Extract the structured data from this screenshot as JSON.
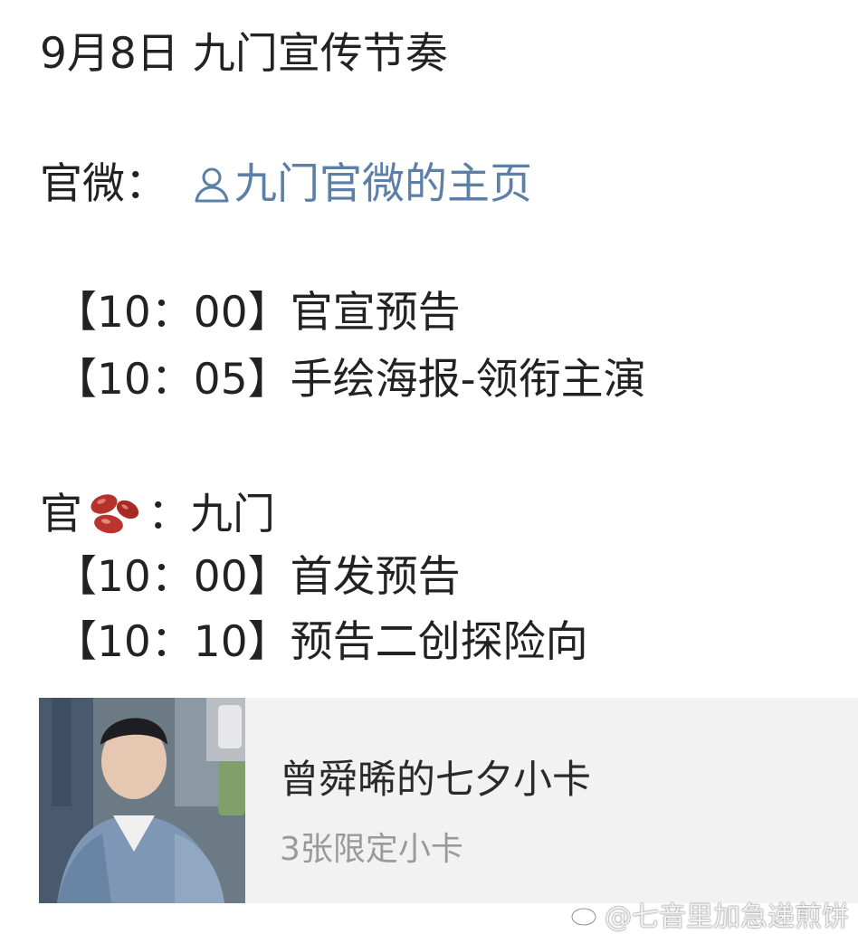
{
  "post": {
    "title": "9月8日 九门宣传节奏",
    "weibo_label": "官微：",
    "weibo_link_text": "九门官微的主页",
    "weibo_schedule": [
      "【10：00】官宣预告",
      "【10：05】手绘海报-领衔主演"
    ],
    "bean_label_prefix": "官",
    "bean_label_suffix": "：九门",
    "bean_schedule": [
      "【10：00】首发预告",
      "【10：10】预告二创探险向"
    ]
  },
  "card": {
    "title": "曾舜晞的七夕小卡",
    "subtitle": "3张限定小卡"
  },
  "watermark": {
    "text": "@七音里加急递煎饼"
  },
  "colors": {
    "link": "#5b7fa6",
    "card_bg": "#f2f2f2",
    "text": "#222222",
    "subtext": "#9a9a9a"
  },
  "icons": {
    "user": "user-outline-icon",
    "bean": "red-bean-emoji-icon",
    "weibo": "weibo-logo-icon"
  }
}
